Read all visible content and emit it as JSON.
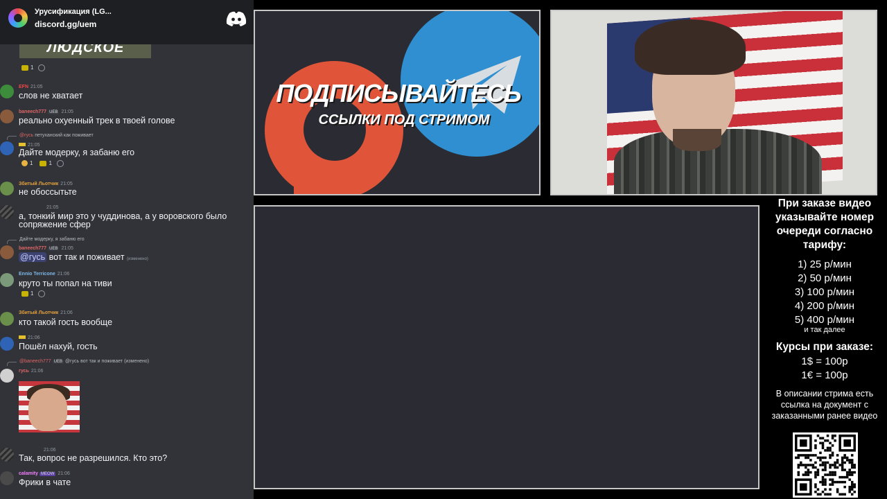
{
  "header": {
    "server_name": "Урусификация (LG...",
    "invite": "discord.gg/uem"
  },
  "banner_text": "ЛЮДСКОЕ",
  "messages": [
    {
      "id": "m0",
      "reactions": [
        {
          "count": "1"
        }
      ]
    },
    {
      "id": "m1",
      "username": "EFN",
      "time": "21:05",
      "text": "слов не хватает",
      "color": "#f04747"
    },
    {
      "id": "m2",
      "username": "baneech777",
      "tag": "UEB",
      "time": "21:05",
      "text": "реально охуенный трек в твоей голове",
      "color": "#e06666"
    },
    {
      "id": "m3",
      "reply_author": "@гусь",
      "reply_text": "петуханский как поживает",
      "time": "21:05",
      "text": "Дайте модерку, я забаню его",
      "reactions": [
        {
          "count": "1"
        },
        {
          "count": "1"
        }
      ]
    },
    {
      "id": "m4",
      "username": "Збитый Льотчик",
      "time": "21:05",
      "text": "не обоссытьте",
      "color": "#e6a23c"
    },
    {
      "id": "m5",
      "time": "21:05",
      "text": "а, тонкий мир это у чуддинова, а у воровского было сопряжение сфер"
    },
    {
      "id": "m6",
      "reply_text": "Дайте модерку, я забаню его",
      "username": "baneech777",
      "tag": "UEB",
      "time": "21:05",
      "mention": "@гусь",
      "text": "вот так и поживает",
      "edited": "(изменено)",
      "color": "#e06666"
    },
    {
      "id": "m7",
      "username": "Ennio Terricone",
      "time": "21:06",
      "text": "круто ты попал на тиви",
      "reactions": [
        {
          "count": "1"
        }
      ],
      "color": "#7fb8e8"
    },
    {
      "id": "m8",
      "username": "Збитый Льотчик",
      "time": "21:06",
      "text": "кто такой гость вообще",
      "color": "#e6a23c"
    },
    {
      "id": "m9",
      "time": "21:06",
      "text": "Пошёл нахуй, гость"
    },
    {
      "id": "m10",
      "reply_author": "@baneech777",
      "reply_tag": "UEB",
      "reply_text": "@гусь вот так и поживает",
      "reply_edited": "(изменено)",
      "username": "гусь",
      "time": "21:06",
      "color": "#e06666"
    },
    {
      "id": "m11",
      "time": "21:06",
      "text": "Так, вопрос не разрешился. Кто это?"
    },
    {
      "id": "m12",
      "username": "calamity",
      "tag": "MEOW",
      "time": "21:06",
      "text": "Фрики в чате",
      "color": "#f47fff"
    }
  ],
  "promo": {
    "title": "ПОДПИСЫВАЙТЕСЬ",
    "subtitle": "ССЫЛКИ ПОД СТРИМОМ"
  },
  "info": {
    "heading": "При заказе видео указывайте номер очереди согласно тарифу:",
    "prices": [
      "1) 25 р/мин",
      "2) 50 р/мин",
      "3) 100 р/мин",
      "4) 200 р/мин",
      "5) 400 р/мин"
    ],
    "etc": "и так далее",
    "rates_title": "Курсы при заказе:",
    "rates": [
      "1$ = 100р",
      "1€ = 100р"
    ],
    "description": "В описании стрима есть ссылка на документ с заказанными ранее видео"
  },
  "colors": {
    "discord_bg": "#313338",
    "discord_header": "#1e1f22",
    "patreon": "#e0553a",
    "telegram": "#2f8fd0"
  },
  "icons": [
    "server-icon",
    "discord-icon",
    "patreon-logo",
    "telegram-logo",
    "qr-code"
  ]
}
